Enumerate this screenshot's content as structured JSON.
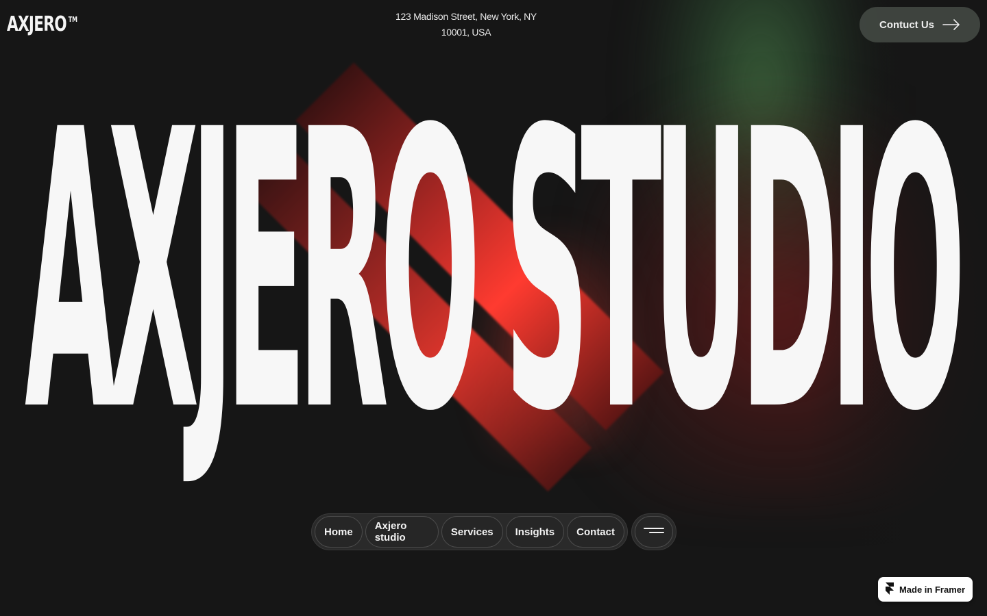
{
  "brand": {
    "name": "AXJERO",
    "tm": "TM"
  },
  "header": {
    "address_line1": "123 Madison Street, New York, NY",
    "address_line2": "10001, USA",
    "cta_label": "Contuct Us"
  },
  "hero": {
    "headline": "AXJERO STUDIO"
  },
  "nav": {
    "items": [
      {
        "label": "Home"
      },
      {
        "label": "Axjero studio"
      },
      {
        "label": "Services"
      },
      {
        "label": "Insights"
      },
      {
        "label": "Contact"
      }
    ],
    "menu_icon": "hamburger-icon"
  },
  "badge": {
    "label": "Made in Framer",
    "icon": "framer-logo-icon"
  },
  "colors": {
    "background": "#161616",
    "text": "#f7f7f7",
    "accent_red": "#ff3b30",
    "accent_green": "#467846",
    "cta_bg": "#424842"
  }
}
